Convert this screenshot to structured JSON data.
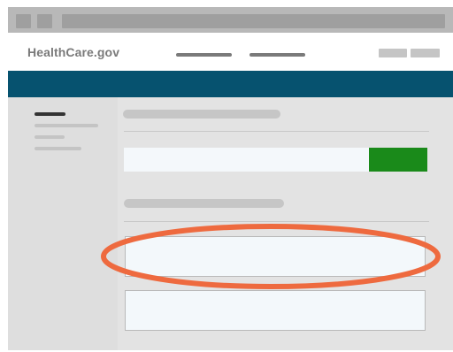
{
  "site": {
    "logo_text": "HealthCare.gov"
  },
  "colors": {
    "header_bar": "#06526f",
    "search_button": "#1a8a1a",
    "highlight_ring": "#ee6a3f"
  },
  "icons": {
    "highlight": "orange-ellipse-highlight"
  }
}
